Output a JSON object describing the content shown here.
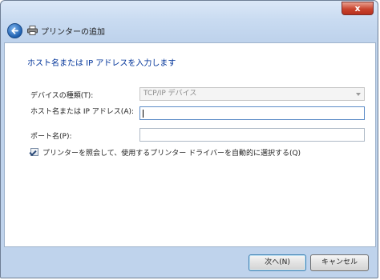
{
  "window": {
    "close_glyph": "x"
  },
  "nav": {
    "title": "プリンターの追加",
    "back_icon": "back-arrow-icon",
    "printer_icon": "printer-icon"
  },
  "form": {
    "heading": "ホスト名または IP アドレスを入力します",
    "device_type_label": "デバイスの種類(T):",
    "device_type_value": "TCP/IP デバイス",
    "host_label": "ホスト名または IP アドレス(A):",
    "host_value": "",
    "port_label": "ポート名(P):",
    "port_value": "",
    "query_checkbox_label": "プリンターを照会して、使用するプリンター ドライバーを自動的に選択する(Q)",
    "query_checkbox_checked": true
  },
  "footer": {
    "next_label": "次へ(N)",
    "cancel_label": "キャンセル"
  },
  "colors": {
    "heading": "#003399",
    "frame": "#c9dbf1",
    "close": "#c9452f"
  }
}
